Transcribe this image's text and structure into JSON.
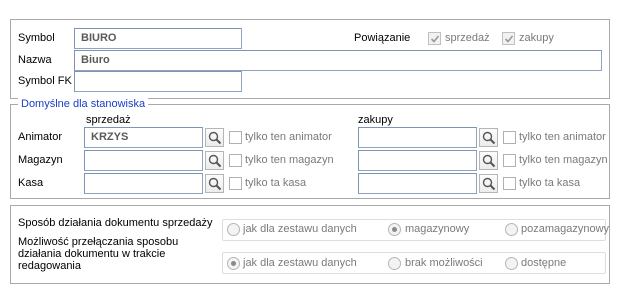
{
  "header": {
    "symbol_label": "Symbol",
    "symbol_value": "BIURO",
    "name_label": "Nazwa",
    "name_value": "Biuro",
    "symbol_fk_label": "Symbol FK",
    "symbol_fk_value": "",
    "binding_label": "Powiązanie",
    "sales_label": "sprzedaż",
    "purchases_label": "zakupy",
    "sales_checked": true,
    "purchases_checked": true
  },
  "defaults": {
    "legend": "Domyślne dla stanowiska",
    "sales_header": "sprzedaż",
    "purchases_header": "zakupy",
    "rows": [
      {
        "label": "Animator",
        "sales_value": "KRZYS",
        "sales_only": "tylko ten animator",
        "purchases_value": "",
        "purchases_only": "tylko ten animator"
      },
      {
        "label": "Magazyn",
        "sales_value": "",
        "sales_only": "tylko ten magazyn",
        "purchases_value": "",
        "purchases_only": "tylko ten magazyn"
      },
      {
        "label": "Kasa",
        "sales_value": "",
        "sales_only": "tylko ta kasa",
        "purchases_value": "",
        "purchases_only": "tylko ta kasa"
      }
    ]
  },
  "mode": {
    "sales_doc_label": "Sposób działania dokumentu sprzedaży",
    "sales_doc_options": [
      "jak dla zestawu danych",
      "magazynowy",
      "pozamagazynowy"
    ],
    "sales_doc_selected": 1,
    "switch_label": "Możliwość przełączania sposobu działania dokumentu w trakcie redagowania",
    "switch_options": [
      "jak dla zestawu danych",
      "brak możliwości",
      "dostępne"
    ],
    "switch_selected": 0
  },
  "colors": {
    "legend_text": "#1a3ec9",
    "field_text": "#5a5a5a",
    "field_border": "#8fa3c0"
  },
  "icons": {
    "search": "magnifier-icon",
    "check": "checkmark-icon"
  }
}
